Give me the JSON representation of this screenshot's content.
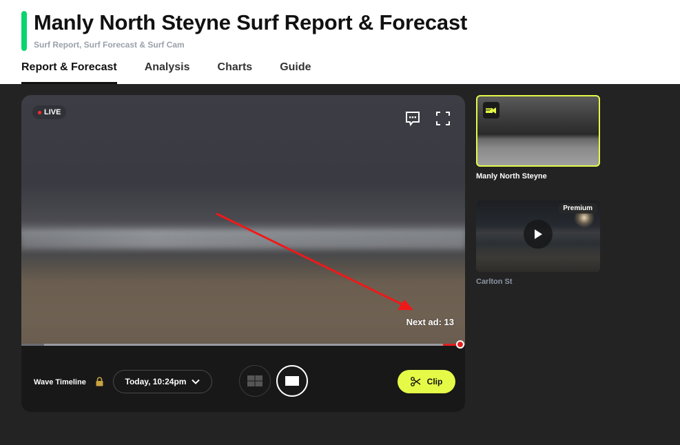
{
  "header": {
    "title": "Manly North Steyne Surf Report & Forecast",
    "subtitle": "Surf Report, Surf Forecast & Surf Cam",
    "accent_color": "#0ad46f",
    "tabs": [
      {
        "label": "Report & Forecast",
        "active": true
      },
      {
        "label": "Analysis",
        "active": false
      },
      {
        "label": "Charts",
        "active": false
      },
      {
        "label": "Guide",
        "active": false
      }
    ]
  },
  "player": {
    "live_label": "LIVE",
    "live_color": "#ff2b2b",
    "next_ad_text": "Next ad: 13",
    "progress_percent": 96,
    "icons": {
      "chat": "chat-bubble-icon",
      "fullscreen": "fullscreen-icon"
    },
    "controls": {
      "wave_timeline_label": "Wave Timeline",
      "lock_icon": "lock-icon",
      "time_select_value": "Today, 10:24pm",
      "layout_options": [
        {
          "name": "multi-cam-grid",
          "active": false
        },
        {
          "name": "single-cam",
          "active": true
        }
      ],
      "clip_label": "Clip",
      "clip_color": "#e5fa47"
    }
  },
  "cams": [
    {
      "name": "Manly North Steyne",
      "selected": true,
      "badge_icon": "camera-icon"
    },
    {
      "name": "Carlton St",
      "selected": false,
      "badge": "Premium"
    }
  ]
}
